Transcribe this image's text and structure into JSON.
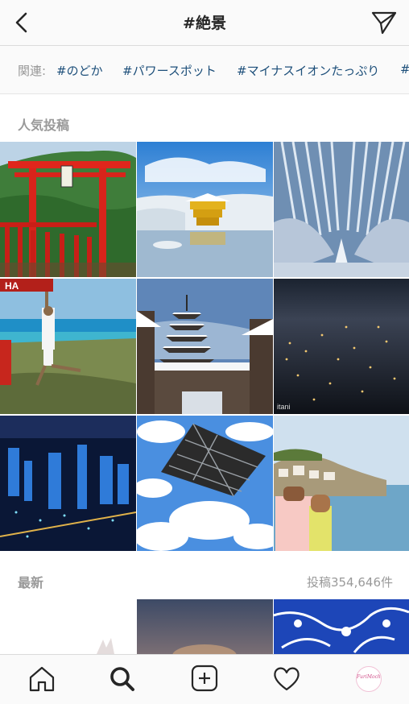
{
  "header": {
    "title": "#絶景",
    "back_icon": "chevron-left-icon",
    "send_icon": "paper-plane-icon"
  },
  "related": {
    "label": "関連:",
    "tags": [
      "#のどか",
      "#パワースポット",
      "#マイナスイオンたっぷり",
      "#"
    ]
  },
  "popular": {
    "heading": "人気投稿",
    "posts": [
      {
        "subject": "red torii gates on green coastal hill"
      },
      {
        "subject": "golden pavilion in snow reflected in pond"
      },
      {
        "subject": "snowy bamboo forest path"
      },
      {
        "subject": "man hanging from beach sign above turquoise sea",
        "sign_text": "HA"
      },
      {
        "subject": "five-storey pagoda above snowy old street"
      },
      {
        "subject": "city night view from mountain",
        "watermark": "itani"
      },
      {
        "subject": "blue city skyline at night"
      },
      {
        "subject": "steel tower against cloudy blue sky"
      },
      {
        "subject": "couple posing on coastal cliff town"
      }
    ]
  },
  "recent": {
    "heading": "最新",
    "count": "投稿354,646件"
  },
  "tabbar": {
    "items": [
      "home-icon",
      "search-icon",
      "new-post-icon",
      "activity-heart-icon"
    ],
    "profile_label": "FuriMochi",
    "accent": "#d0508a"
  }
}
